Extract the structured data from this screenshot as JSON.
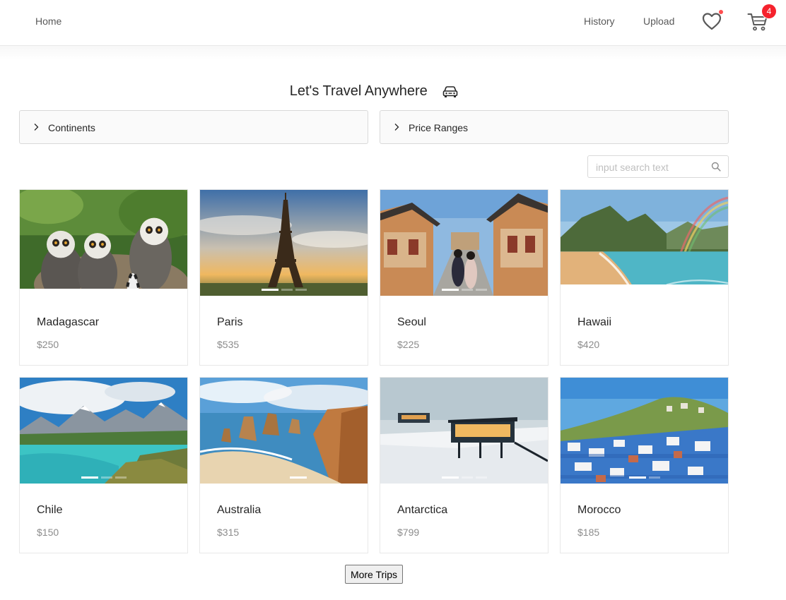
{
  "nav": {
    "home": "Home",
    "history": "History",
    "upload": "Upload",
    "cart_count": "4",
    "heart_icon": "heart-icon",
    "cart_icon": "shopping-cart-icon"
  },
  "title": "Let's Travel Anywhere",
  "title_icon": "car-icon",
  "filters": {
    "continents": "Continents",
    "price_ranges": "Price Ranges"
  },
  "search": {
    "placeholder": "input search text",
    "value": ""
  },
  "trips": [
    {
      "name": "Madagascar",
      "price": "$250"
    },
    {
      "name": "Paris",
      "price": "$535"
    },
    {
      "name": "Seoul",
      "price": "$225"
    },
    {
      "name": "Hawaii",
      "price": "$420"
    },
    {
      "name": "Chile",
      "price": "$150"
    },
    {
      "name": "Australia",
      "price": "$315"
    },
    {
      "name": "Antarctica",
      "price": "$799"
    },
    {
      "name": "Morocco",
      "price": "$185"
    }
  ],
  "more_button": "More Trips",
  "colors": {
    "badge": "#f5222d",
    "text": "#262626",
    "muted": "#8c8c8c",
    "border": "#e8e8e8"
  }
}
